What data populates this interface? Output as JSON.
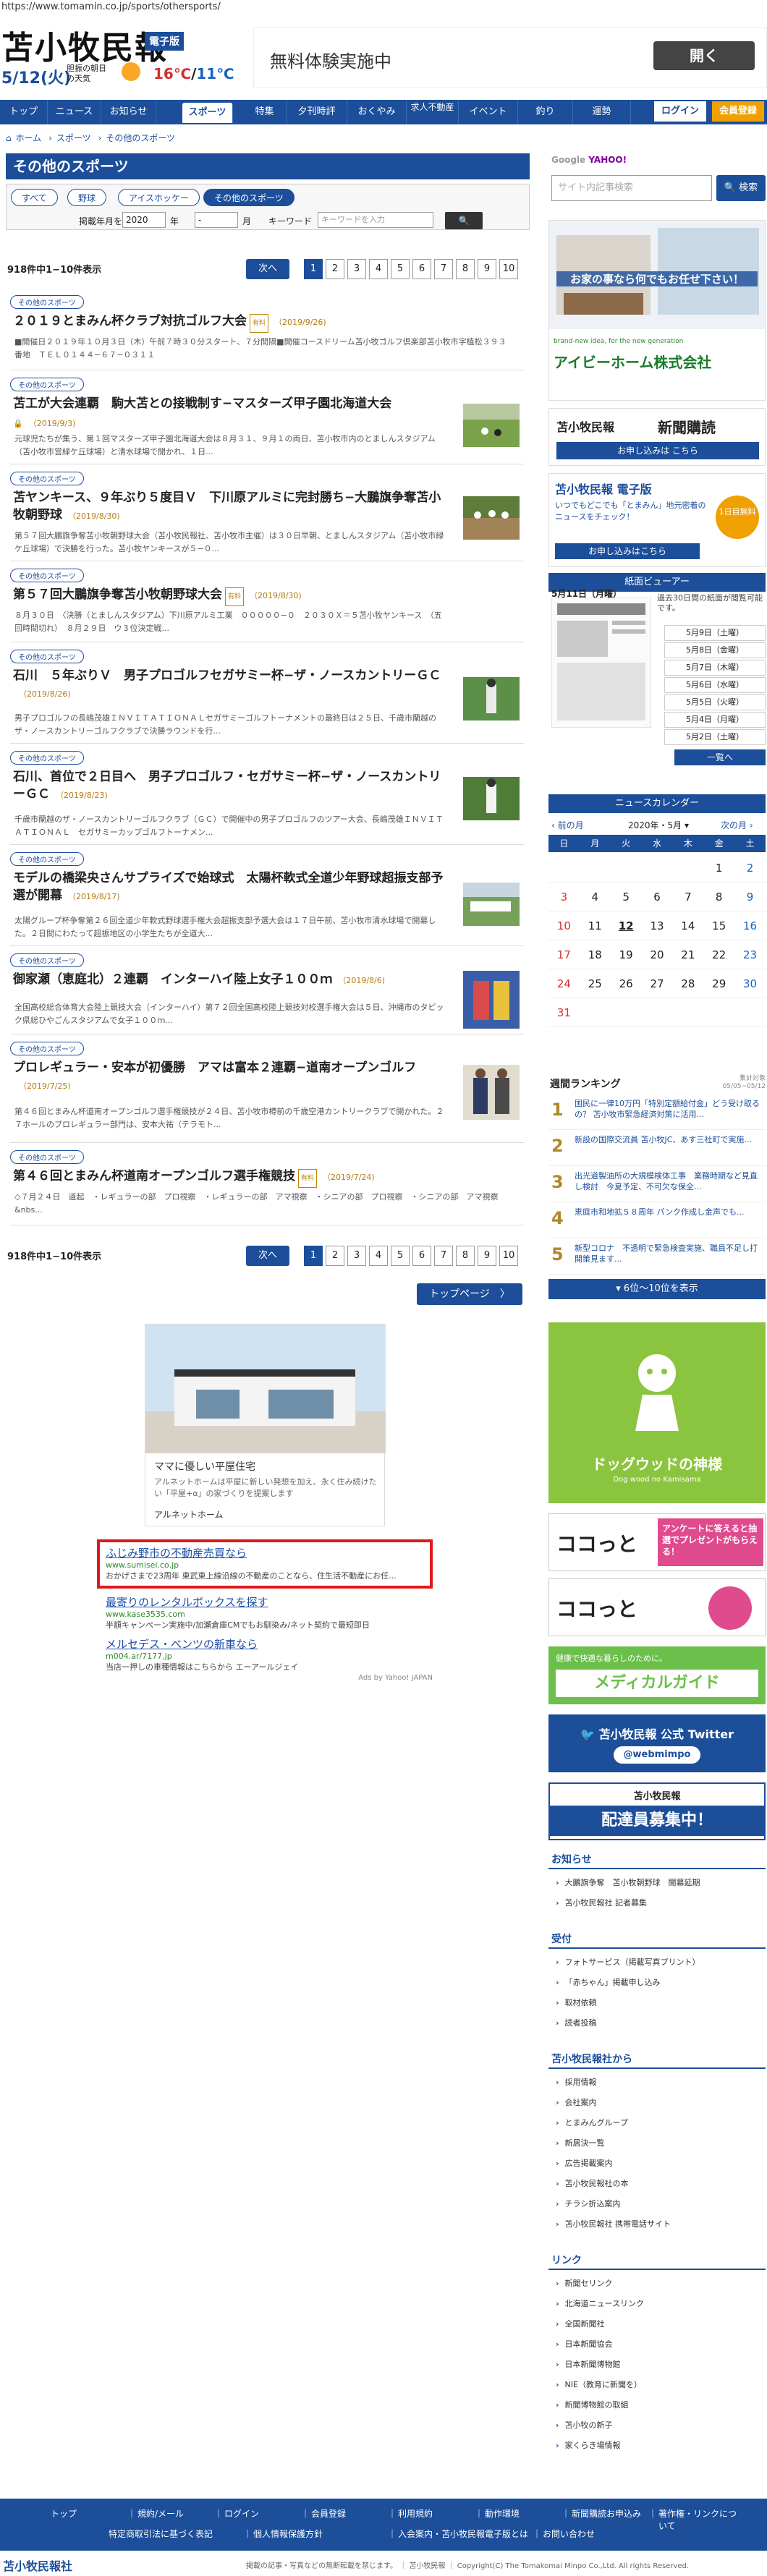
{
  "url": "https://www.tomamin.co.jp/sports/othersports/",
  "header": {
    "logo": "苫小牧民報",
    "logo_badge": "電子版",
    "date": "5/12(火)",
    "weather_label": "胆振の朝日の天気",
    "temp_hi": "16℃",
    "temp_lo": "11℃",
    "temp_sep": "/"
  },
  "top_ad": {
    "text": "無料体験実施中",
    "button": "開く"
  },
  "nav": {
    "items": [
      "トップ",
      "ニュース",
      "お知らせ",
      "スポーツ",
      "特集",
      "夕刊時評",
      "おくやみ",
      "求人不動産",
      "イベント",
      "釣り",
      "運勢"
    ],
    "login": "ログイン",
    "member": "会員登録"
  },
  "breadcrumb": [
    "ホーム",
    "スポーツ",
    "その他のスポーツ"
  ],
  "section_title": "その他のスポーツ",
  "cat_tabs": [
    "すべて",
    "野球",
    "アイスホッケー",
    "その他のスポーツ"
  ],
  "filter": {
    "label": "掲載年月を選択",
    "year": "2020",
    "year_unit": "年",
    "month": "-",
    "month_unit": "月",
    "keyword_label": "キーワード",
    "keyword_placeholder": "キーワードを入力"
  },
  "count": "918件中1−10件表示",
  "next": "次へ",
  "pages": [
    "1",
    "2",
    "3",
    "4",
    "5",
    "6",
    "7",
    "8",
    "9",
    "10"
  ],
  "articles": [
    {
      "tag": "その他のスポーツ",
      "title": "２０１９とまみん杯クラブ対抗ゴルフ大会",
      "fee": "有料",
      "date": "（2019/9/26)",
      "text": "■開催日２０１９年１０月３日（木）午前７時３０分スタート、７分間隔■開催コースドリーム苫小牧ゴルフ倶楽部苫小牧市字植松３９３番地　ＴＥＬ０１４４−６７−０３１１"
    },
    {
      "tag": "その他のスポーツ",
      "title": "苫工が大会連覇　駒大苫との接戦制す−マスターズ甲子園北海道大会",
      "fee": "",
      "date": "（2019/9/3)",
      "text": "元球児たちが集う、第１回マスターズ甲子園北海道大会は８月３１、９月１の両日、苫小牧市内のとましんスタジアム（苫小牧市営緑ケ丘球場）と清水球場で開かれ、１日..."
    },
    {
      "tag": "その他のスポーツ",
      "title": "苫ヤンキース、９年ぶり５度目Ｖ　下川原アルミに完封勝ち−大鵬旗争奪苫小牧朝野球",
      "fee": "",
      "date": "（2019/8/30)",
      "text": "第５７回大鵬旗争奪苫小牧朝野球大会（苫小牧民報社、苫小牧市主催）は３０日早朝、とましんスタジアム（苫小牧市緑ケ丘球場）で決勝を行った。苫小牧ヤンキースが５−０..."
    },
    {
      "tag": "その他のスポーツ",
      "title": "第５７回大鵬旗争奪苫小牧朝野球大会",
      "fee": "有料",
      "date": "（2019/8/30)",
      "text": "８月３０日　〈決勝（とましんスタジアム）下川原アルミ工業　０００００−０　２０３０Ｘ＝５苫小牧ヤンキース　（五回時間切れ）　８月２９日　ウ３位決定戦..."
    },
    {
      "tag": "その他のスポーツ",
      "title": "石川　５年ぶりＶ　男子プロゴルフセガサミー杯−ザ・ノースカントリーＧＣ",
      "fee": "",
      "date": "（2019/8/26)",
      "text": "男子プロゴルフの長嶋茂雄ＩＮＶＩＴＡＴＩＯＮＡＬセガサミーゴルフトーナメントの最終日は２５日、千歳市蘭越のザ・ノースカントリーゴルフクラブで決勝ラウンドを行..."
    },
    {
      "tag": "その他のスポーツ",
      "title": "石川、首位で２日目へ　男子プロゴルフ・セガサミー杯−ザ・ノースカントリーＧＣ",
      "fee": "",
      "date": "（2019/8/23)",
      "text": "千歳市蘭越のザ・ノースカントリーゴルフクラブ（ＧＣ）で開催中の男子プロゴルフのツアー大会、長嶋茂雄ＩＮＶＩＴＡＴＩＯＮＡＬ　セガサミーカップゴルフトーナメン..."
    },
    {
      "tag": "その他のスポーツ",
      "title": "モデルの橋梁央さんサプライズで始球式　太陽杯軟式全道少年野球超振支部予選が開幕",
      "fee": "",
      "date": "（2019/8/17)",
      "text": "太陽グループ杯争奪第２６回全道少年軟式野球選手権大会超振支部予選大会は１７日午前、苫小牧市清水球場で開幕した。２日間にわたって超振地区の小学生たちが全道大..."
    },
    {
      "tag": "その他のスポーツ",
      "title": "御家瀬（恵庭北）２連覇　インターハイ陸上女子１００ｍ",
      "fee": "",
      "date": "（2019/8/6)",
      "text": "全国高校総合体育大会陸上競技大会（インターハイ）第７２回全国高校陸上競技対校選手権大会は５日、沖縄市のタピック県総ひやごんスタジアムで女子１００ｍ..."
    },
    {
      "tag": "その他のスポーツ",
      "title": "プロレギュラー・安本が初優勝　アマは富本２連覇−道南オープンゴルフ",
      "fee": "",
      "date": "（2019/7/25)",
      "text": "第４６回とまみん杯道南オープンゴルフ選手権競技が２４日、苫小牧市樽前の千歳空港カントリークラブで開かれた。２７ホールのプロレギュラー部門は、安本大祐（テラモト..."
    },
    {
      "tag": "その他のスポーツ",
      "title": "第４６回とまみん杯道南オープンゴルフ選手権競技",
      "fee": "有料",
      "date": "（2019/7/24)",
      "text": "◇７月２４日　道起　・レギュラーの部　プロ視察　・レギュラーの部　アマ視察　・シニアの部　プロ視察　・シニアの部　アマ視察 &nbs..."
    }
  ],
  "more": "トップページ　〉",
  "ad_home": {
    "headline": "ママに優しい平屋住宅",
    "text": "アルネットホームは平屋に新しい発想を加え、永く住み続けたい「平屋+α」の家づくりを提案します",
    "brand": "アルネットホーム"
  },
  "yahoo_ads": [
    {
      "title": "ふじみ野市の不動産売買なら",
      "url": "www.sumisei.co.jp",
      "desc": "おかげさまで23周年 東武東上線沿線の不動産のことなら、住生活不動産にお任..."
    },
    {
      "title": "最寄りのレンタルボックスを探す",
      "url": "www.kase3535.com",
      "desc": "半額キャンペーン実施中/加瀬倉庫CMでもお馴染み/ネット契約で最短即日"
    },
    {
      "title": "メルセデス・ベンツの新車なら",
      "url": "m004.ar/7177.jp",
      "desc": "当店一押しの車種情報はこちらから エーアールジェイ"
    }
  ],
  "yahoo_ads_label": "Ads by Yahoo! JAPAN",
  "sidebar": {
    "search_placeholder": "サイト内記事検索",
    "search_btn": "検索",
    "ad_house": {
      "brand": "アイビーホーム株式会社",
      "tagline": "brand-new idea, for the new generation",
      "catch": "お家の事なら何でもお任せ下さい！"
    },
    "subscribe": {
      "title": "新聞購読",
      "link": "お申し込みは こちら"
    },
    "digital": {
      "title": "苫小牧民報 電子版",
      "catch": "いつでもどこでも「とまみん」地元密着のニュースをチェック！",
      "link": "お申し込みはこちら",
      "badge": "1日目無料"
    },
    "viewer_title": "紙面ビューアー",
    "viewer_date": "5月11日（月曜）",
    "viewer_note": "過去30日間の紙面が閲覧可能です。",
    "viewer_dates": [
      "5月9日（土曜）",
      "5月8日（金曜）",
      "5月7日（木曜）",
      "5月6日（水曜）",
      "5月5日（火曜）",
      "5月4日（月曜）",
      "5月2日（土曜）"
    ],
    "viewer_list": "一覧へ",
    "calendar_title": "ニュースカレンダー",
    "cal_prev": "前の月",
    "cal_month": "2020年・5月",
    "cal_next": "次の月",
    "cal_days": [
      "日",
      "月",
      "火",
      "水",
      "木",
      "金",
      "土"
    ],
    "cal_weeks": [
      [
        "",
        "",
        "",
        "",
        "",
        "1",
        "2"
      ],
      [
        "3",
        "4",
        "5",
        "6",
        "7",
        "8",
        "9"
      ],
      [
        "10",
        "11",
        "12",
        "13",
        "14",
        "15",
        "16"
      ],
      [
        "17",
        "18",
        "19",
        "20",
        "21",
        "22",
        "23"
      ],
      [
        "24",
        "25",
        "26",
        "27",
        "28",
        "29",
        "30"
      ],
      [
        "31",
        "",
        "",
        "",
        "",
        "",
        ""
      ]
    ],
    "ranking_title": "週間ランキング",
    "ranking_range": "05/05−05/12",
    "ranking_note": "集計対象",
    "ranking": [
      "国民に一律10万円「特別定額給付金」どう受け取るの？ 苫小牧市緊急経済対策に活用...",
      "新設の国際交流員 苫小牧JC、あす三社町で実施...",
      "出光道製油所の大規模検体工事　業務時期など見直し検討　今夏予定、不可欠な保全...",
      "恵庭市和地拡５８周年 パンク作成し金声でも...",
      "新型コロナ　不透明で緊急検査実施、職員不足し打開策見ます...",
      "5"
    ],
    "ranking_more": "6位〜10位を表示",
    "dog_title": "ドッグウッドの神様",
    "dog_sub": "Dog wood no Kamisama",
    "kokotto1": "ココっと",
    "kokotto1_note": "アンケートに答えると抽選でプレゼントがもらえる！",
    "kokotto2": "ココっと",
    "medical": "メディカルガイド",
    "medical_sub": "健康で快適な暮らしのために。",
    "twitter": "苫小牧民報 公式 Twitter",
    "twitter_handle": "@webmimpo",
    "recruit": "配達員募集中！",
    "recruit_brand": "苫小牧民報",
    "lists": [
      {
        "title": "お知らせ",
        "items": [
          "大鵬旗争奪　苫小牧朝野球　開幕延期",
          "苫小牧民報社 記者募集"
        ]
      },
      {
        "title": "受付",
        "items": [
          "フォトサービス（掲載写真プリント）",
          "「赤ちゃん」掲載申し込み",
          "取材依頼",
          "読者投稿"
        ]
      },
      {
        "title": "苫小牧民報社から",
        "items": [
          "採用情報",
          "会社案内",
          "とまみんグループ",
          "新居決一覧",
          "広告掲載案内",
          "苫小牧民報社の本",
          "チラシ折込案内",
          "苫小牧民報社 携帯電話サイト"
        ]
      },
      {
        "title": "リンク",
        "items": [
          "新聞セリンク",
          "北海道ニュースリンク",
          "全国新聞社",
          "日本新聞協会",
          "日本新聞博物館",
          "NIE（教育に新聞を）",
          "新聞博物館の取組",
          "苫小牧の新子",
          "家くらき場情報"
        ]
      }
    ]
  },
  "footer": {
    "row1": [
      "トップ",
      "規約/メール",
      "ログイン",
      "会員登録",
      "利用規約",
      "動作環境",
      "新聞購読お申込み",
      "著作権・リンクについて"
    ],
    "row2": [
      "特定商取引法に基づく表記",
      "個人情報保護方針",
      "入会案内・苫小牧民報電子版とは",
      "お問い合わせ"
    ],
    "copyright": "Copyright(C) The Tomakomai Minpo Co.,Ltd. All rights Reserved.",
    "notice": "掲載の記事・写真などの無断転載を禁じます。",
    "brand": "苫小牧民報",
    "logo": "苫小牧民報社"
  },
  "colors": {
    "primary": "#1c4e9a",
    "gold": "#f0a000",
    "fee": "#c08400"
  }
}
